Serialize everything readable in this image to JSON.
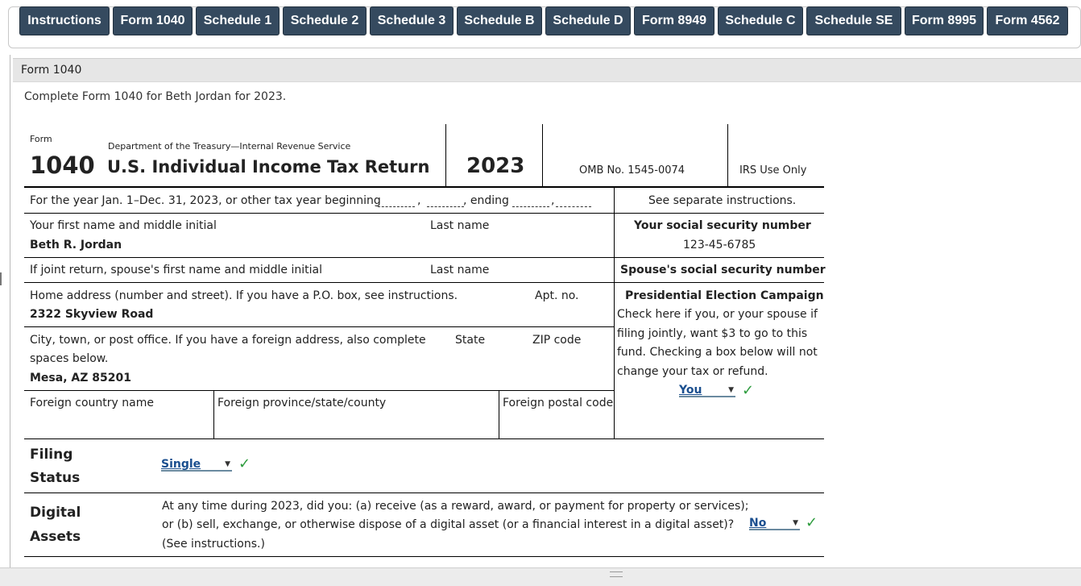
{
  "tabs": [
    {
      "label": "Instructions"
    },
    {
      "label": "Form 1040"
    },
    {
      "label": "Schedule 1"
    },
    {
      "label": "Schedule 2"
    },
    {
      "label": "Schedule 3"
    },
    {
      "label": "Schedule B"
    },
    {
      "label": "Schedule D"
    },
    {
      "label": "Form 8949"
    },
    {
      "label": "Schedule C"
    },
    {
      "label": "Schedule SE"
    },
    {
      "label": "Form 8995"
    },
    {
      "label": "Form 4562"
    }
  ],
  "panel": {
    "title": "Form 1040"
  },
  "intro": "Complete Form 1040 for Beth Jordan for 2023.",
  "form": {
    "form_word": "Form",
    "number": "1040",
    "department": "Department of the Treasury—Internal Revenue Service",
    "title": "U.S. Individual Income Tax Return",
    "year": "2023",
    "omb": "OMB No. 1545-0074",
    "irs_use": "IRS Use Only",
    "tax_year_text": "For the year Jan. 1–Dec. 31, 2023, or other tax year beginning",
    "comma": ",",
    "ending": ", ending",
    "see_instructions": "See separate instructions.",
    "first_name_label": "Your first name and middle initial",
    "last_name_label": "Last name",
    "ssn_label": "Your social security number",
    "first_name_value": "Beth R. Jordan",
    "ssn_value": "123-45-6785",
    "spouse_label": "If joint return, spouse's first name and middle initial",
    "spouse_last_label": "Last name",
    "spouse_ssn_label": "Spouse's social security number",
    "address_label": "Home address (number and street). If you have a P.O. box, see instructions.",
    "apt_label": "Apt. no.",
    "address_value": "2322 Skyview Road",
    "pec_title": "Presidential Election Campaign",
    "pec_lines": [
      "Check here if you, or your spouse if",
      "filing jointly, want $3 to go to this",
      "fund. Checking a box below will not",
      "change your tax or refund."
    ],
    "pec_select": "You",
    "city_label_1": "City, town, or post office. If you have a foreign address, also complete",
    "city_label_2": "spaces below.",
    "state_label": "State",
    "zip_label": "ZIP code",
    "city_value": "Mesa, AZ 85201",
    "foreign_country_label": "Foreign country name",
    "foreign_province_label": "Foreign province/state/county",
    "foreign_postal_label": "Foreign postal code",
    "filing_status_1": "Filing",
    "filing_status_2": "Status",
    "filing_select": "Single",
    "digital_1": "Digital",
    "digital_2": "Assets",
    "digital_q1": "At any time during 2023, did you: (a) receive (as a reward, award, or payment for property or services);",
    "digital_q2": "or (b) sell, exchange, or otherwise dispose of a digital asset (or a financial interest in a digital asset)?",
    "digital_q3": "(See instructions.)",
    "digital_select": "No"
  },
  "icons": {
    "check": "checkmark-icon",
    "caret": "dropdown-caret-icon"
  },
  "colors": {
    "tab_bg": "#354a5f",
    "check": "#2e9c3e",
    "select_text": "#1b4f8f"
  }
}
